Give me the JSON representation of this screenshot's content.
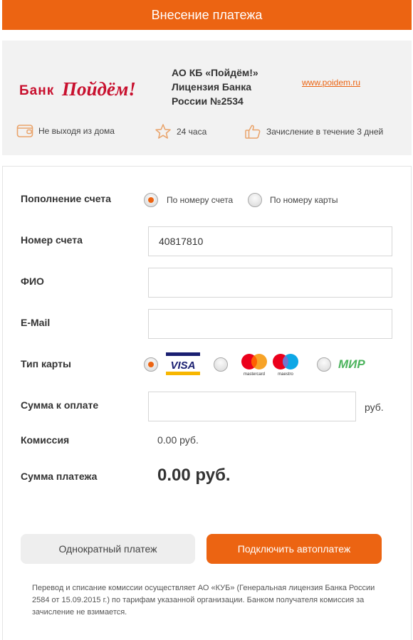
{
  "header": {
    "title": "Внесение платежа"
  },
  "bank": {
    "logo_text_1": "Банк",
    "logo_text_2": "Пойдём!",
    "name_line_1": "АО КБ «Пойдём!»",
    "name_line_2": "Лицензия Банка",
    "name_line_3": "России №2534",
    "site_link": "www.poidem.ru",
    "features": [
      {
        "icon": "wallet-icon",
        "text": "Не выходя из дома"
      },
      {
        "icon": "star-icon",
        "text": "24 часа"
      },
      {
        "icon": "thumbs-up-icon",
        "text": "Зачисление в течение 3 дней"
      }
    ]
  },
  "form": {
    "topup": {
      "label": "Пополнение счета",
      "options": [
        "По номеру счета",
        "По номеру карты"
      ],
      "selected": "По номеру счета"
    },
    "account": {
      "label": "Номер счета",
      "value": "40817810"
    },
    "fio": {
      "label": "ФИО",
      "value": ""
    },
    "email": {
      "label": "E-Mail",
      "value": ""
    },
    "card_type": {
      "label": "Тип карты",
      "options": [
        "visa",
        "mastercard-maestro",
        "mir"
      ],
      "selected": "visa",
      "visa_text": "VISA",
      "mastercard_text": "mastercard",
      "maestro_text": "maestro",
      "mir_text": "МИР"
    },
    "amount": {
      "label": "Сумма к оплате",
      "value": "",
      "unit": "руб."
    },
    "commission": {
      "label": "Комиссия",
      "value": "0.00 руб."
    },
    "total": {
      "label": "Сумма платежа",
      "value": "0.00 руб."
    }
  },
  "buttons": {
    "once": "Однократный платеж",
    "auto": "Подключить автоплатеж"
  },
  "disclaimer": "Перевод и списание комиссии осуществляет АО «КУБ» (Генеральная лицензия Банка России 2584 от 15.09.2015 г.) по тарифам указанной организации. Банком получателя комиссия за зачисление не взимается.",
  "colors": {
    "accent": "#ec6412",
    "panel": "#f2f2f2",
    "logo_red": "#c8102e",
    "visa_blue": "#1a1f71",
    "mir_green": "#4db45e"
  }
}
